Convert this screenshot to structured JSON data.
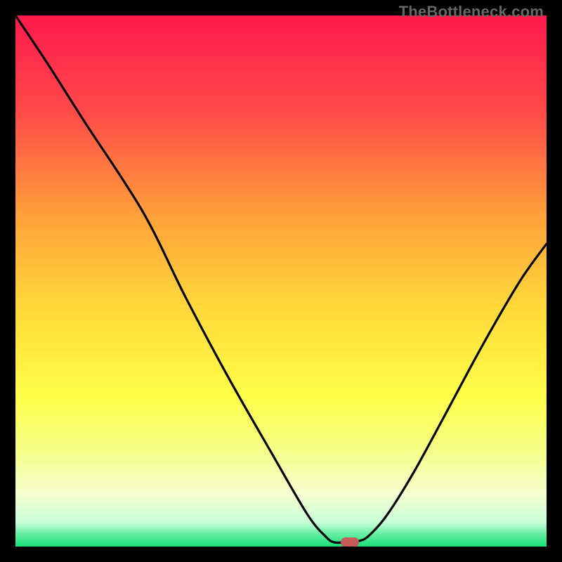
{
  "watermark": "TheBottleneck.com",
  "chart_data": {
    "type": "line",
    "title": "",
    "xlabel": "",
    "ylabel": "",
    "xlim": [
      0,
      100
    ],
    "ylim": [
      0,
      100
    ],
    "gradient_stops": [
      {
        "pos": 0.0,
        "color": "#ff1a4d"
      },
      {
        "pos": 0.18,
        "color": "#ff4a4a"
      },
      {
        "pos": 0.38,
        "color": "#ffa23a"
      },
      {
        "pos": 0.55,
        "color": "#ffd93a"
      },
      {
        "pos": 0.72,
        "color": "#ffff4a"
      },
      {
        "pos": 0.82,
        "color": "#f5ff8a"
      },
      {
        "pos": 0.9,
        "color": "#f8ffd0"
      },
      {
        "pos": 0.955,
        "color": "#c8ffd8"
      },
      {
        "pos": 0.975,
        "color": "#6cf0a8"
      },
      {
        "pos": 1.0,
        "color": "#18e07a"
      }
    ],
    "series": [
      {
        "name": "bottleneck-curve",
        "x": [
          0.0,
          6.0,
          13.0,
          24.0,
          32.0,
          40.0,
          48.0,
          55.0,
          58.5,
          60.0,
          62.0,
          64.5,
          66.5,
          70.0,
          75.0,
          81.0,
          88.0,
          95.0,
          100.0
        ],
        "y": [
          100.0,
          91.0,
          80.0,
          63.0,
          47.0,
          32.0,
          18.0,
          6.0,
          1.8,
          0.8,
          0.8,
          1.0,
          2.0,
          6.0,
          14.0,
          25.0,
          38.0,
          50.0,
          57.0
        ]
      }
    ],
    "marker": {
      "x": 63.0,
      "y": 0.8,
      "color": "#c95a5a"
    }
  }
}
